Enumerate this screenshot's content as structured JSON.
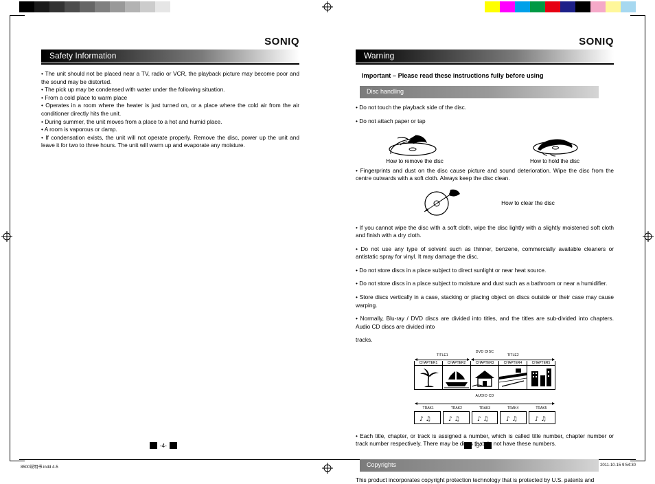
{
  "document": {
    "brand": "SONIQ",
    "left_page": {
      "header": "Safety Information",
      "paragraphs": [
        "• The unit should not be placed near a TV, radio or VCR, the playback picture may become poor and the sound may be distorted.",
        "• The pick up may be condensed with water under the following situation.",
        "• From a cold place to warm place",
        "• Operates in a room where the heater is just turned on, or a place where the cold air from the air conditioner directly hits the unit.",
        "• During summer, the unit moves from a place to a hot and humid place.",
        "• A room is vaporous or damp.",
        "• If condensation exists, the unit will not operate properly. Remove the disc, power up the unit and leave it for two to three hours. The unit will warm up and evaporate any moisture."
      ],
      "page_number": "-4-"
    },
    "right_page": {
      "header": "Warning",
      "important_line": "Important – Please read these instructions fully before using",
      "sections": [
        {
          "title": "Disc handling"
        },
        {
          "title": "Copyrights"
        }
      ],
      "disc_bullets_top": [
        "• Do not touch the playback side of the disc.",
        "• Do not attach paper or tap"
      ],
      "figure_captions": {
        "remove": "How to remove the disc",
        "hold": "How to hold the disc",
        "clear": "How to clear the disc"
      },
      "fingerprint_text": "• Fingerprints and dust on the disc cause picture and sound deterioration. Wipe the disc from the centre outwards with a soft cloth. Always keep the disc clean.",
      "disc_bullets_main": [
        "• If you cannot wipe the disc with a soft cloth, wipe the disc lightly with a slightly moistened soft cloth and finish with a dry cloth.",
        "• Do not use any type of solvent such as thinner, benzene, commercially available cleaners or antistatic spray for vinyl. It may damage the disc.",
        "• Do not store discs in a place subject to direct sunlight or near heat source.",
        "• Do not store discs in a place subject to moisture and dust such as a bathroom or near a humidifier.",
        "• Store discs vertically in a case, stacking or placing object on discs outside or their case may cause warping.",
        "• Normally, Blu-ray / DVD discs are divided into titles, and the titles are sub-divided into chapters. Audio CD discs are divided into",
        "tracks."
      ],
      "after_diagram_text": "• Each title, chapter, or track is assigned a number, which is called title number, chapter number or track number respectively. There may be discs that do not have these numbers.",
      "copyright_text": "This product incorporates copyright protection technology that is protected by U.S. patents and",
      "page_number": "-5-"
    },
    "diagram": {
      "dvd_label": "DVD DISC",
      "titles": [
        "TITLE1",
        "TITLE2"
      ],
      "chapters": [
        "CHAPTER1",
        "CHAPTER2",
        "CHAPTER3",
        "CHAPTER4",
        "CHAPTER5"
      ],
      "audio_label": "AUDIO CD",
      "tracks": [
        "TRAK1",
        "TRAK2",
        "TRAK3",
        "TRAK4",
        "TRAK5"
      ]
    },
    "footer": {
      "left_note": "8500说明书.indd   4-5",
      "right_note": "2011-10-15   9:54:30"
    },
    "swatches_left": [
      "#000000",
      "#1a1a1a",
      "#333333",
      "#4d4d4d",
      "#666666",
      "#808080",
      "#999999",
      "#b3b3b3",
      "#cccccc",
      "#e6e6e6",
      "#ffffff"
    ],
    "swatches_right": [
      "#ffffff",
      "#ffff00",
      "#ff00ff",
      "#00a0e9",
      "#009944",
      "#e60012",
      "#1d2088",
      "#000000",
      "#f5a9c8",
      "#fff79a",
      "#a6d8f0"
    ]
  }
}
